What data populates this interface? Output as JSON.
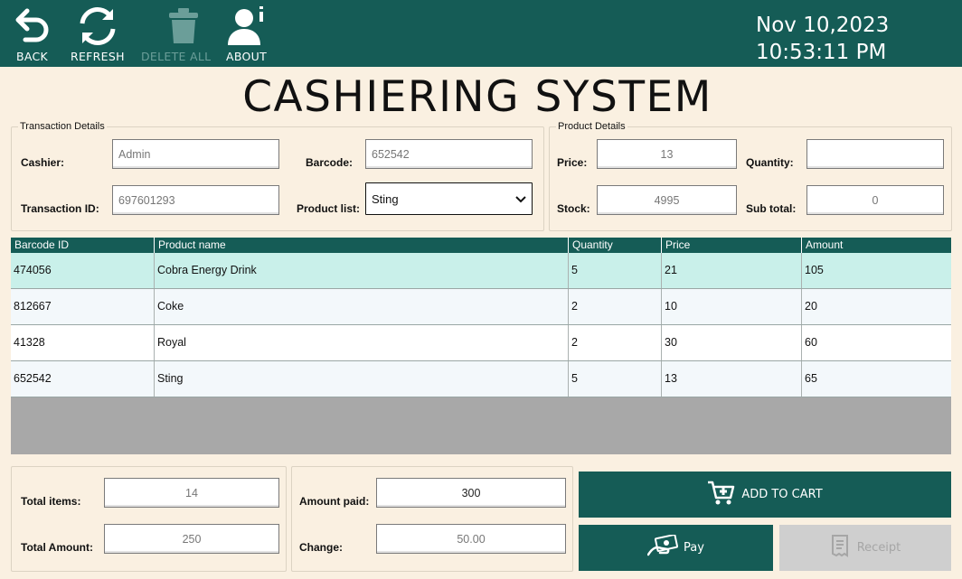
{
  "toolbar": {
    "back": "BACK",
    "refresh": "REFRESH",
    "delete_all": "DELETE ALL",
    "about": "ABOUT"
  },
  "clock": {
    "date": "Nov 10,2023",
    "time": "10:53:11 PM"
  },
  "title": "CASHIERING SYSTEM",
  "transaction": {
    "legend": "Transaction Details",
    "cashier_label": "Cashier:",
    "cashier_value": "Admin",
    "txid_label": "Transaction ID:",
    "txid_value": "697601293",
    "barcode_label": "Barcode:",
    "barcode_value": "652542",
    "product_label": "Product list:",
    "product_value": "Sting"
  },
  "product": {
    "legend": "Product Details",
    "price_label": "Price:",
    "price_value": "13",
    "stock_label": "Stock:",
    "stock_value": "4995",
    "quantity_label": "Quantity:",
    "quantity_value": "",
    "subtotal_label": "Sub total:",
    "subtotal_value": "0"
  },
  "table": {
    "headers": [
      "Barcode ID",
      "Product name",
      "Quantity",
      "Price",
      "Amount"
    ],
    "rows": [
      [
        "474056",
        "Cobra Energy Drink",
        "5",
        "21",
        "105"
      ],
      [
        "812667",
        "Coke",
        "2",
        "10",
        "20"
      ],
      [
        "41328",
        "Royal",
        "2",
        "30",
        "60"
      ],
      [
        "652542",
        "Sting",
        "5",
        "13",
        "65"
      ]
    ]
  },
  "totals": {
    "items_label": "Total items:",
    "items_value": "14",
    "amount_label": "Total Amount:",
    "amount_value": "250"
  },
  "payment": {
    "paid_label": "Amount paid:",
    "paid_value": "300",
    "change_label": "Change:",
    "change_value": "50.00"
  },
  "actions": {
    "add_to_cart": "ADD TO CART",
    "pay": "Pay",
    "receipt": "Receipt"
  },
  "colors": {
    "primary": "#155c56",
    "background": "#faf0e1",
    "selected_row": "#c9f0ea",
    "alt_row": "#f3f8fb"
  },
  "icons": {
    "back": "undo-arrow-icon",
    "refresh": "refresh-icon",
    "delete_all": "trash-icon",
    "about": "user-info-icon",
    "cart": "cart-plus-icon",
    "pay": "hand-cash-icon",
    "receipt": "receipt-icon"
  }
}
